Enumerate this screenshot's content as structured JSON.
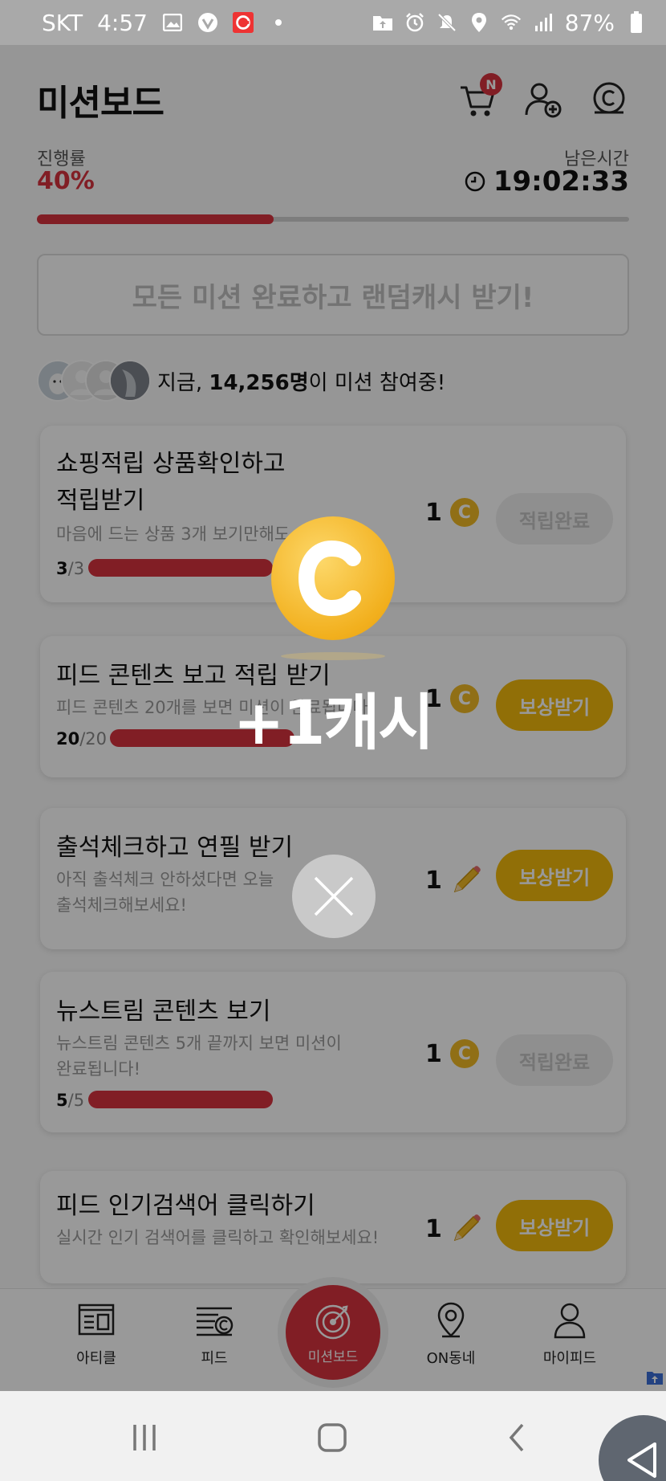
{
  "status_bar": {
    "carrier": "SKT",
    "time": "4:57",
    "battery": "87%",
    "icons": [
      "image-icon",
      "vivaldi-icon",
      "app-c-icon",
      "dot-icon",
      "upload-folder-icon",
      "alarm-icon",
      "mute-icon",
      "location-icon",
      "wifi-icon",
      "signal-icon",
      "battery-icon"
    ]
  },
  "header": {
    "title": "미션보드",
    "cart_badge": "N",
    "icons": [
      "cart-icon",
      "add-friend-icon",
      "cash-icon"
    ]
  },
  "progress": {
    "label": "진행률",
    "value": "40%",
    "fraction": 0.4,
    "time_label": "남은시간",
    "time_value": "19:02:33"
  },
  "all_missions_banner": "모든 미션 완료하고 랜덤캐시 받기!",
  "participants": {
    "prefix": "지금, ",
    "count": "14,256명",
    "suffix": "이 미션 참여중!"
  },
  "missions": [
    {
      "title1": "쇼핑적립 상품확인하고",
      "title2": "적립받기",
      "desc1": "마음에 드는 상품 3개 보기만해도",
      "done": "3",
      "total": "/3",
      "fraction": 1.0,
      "reward": "1",
      "reward_icon": "coin-icon",
      "button": "적립완료",
      "state": "done"
    },
    {
      "title1": "피드 콘텐츠 보고 적립 받기",
      "desc1": "피드 콘텐츠 20개를 보면 미션이 완료됩니다!",
      "done": "20",
      "total": "/20",
      "fraction": 1.0,
      "reward": "1",
      "reward_icon": "coin-icon",
      "button": "보상받기",
      "state": "claim"
    },
    {
      "title1": "출석체크하고 연필 받기",
      "desc1": "아직 출석체크 안하셨다면 오늘",
      "desc2": "출석체크해보세요!",
      "reward": "1",
      "reward_icon": "pencil-icon",
      "button": "보상받기",
      "state": "claim"
    },
    {
      "title1": "뉴스트림 콘텐츠 보기",
      "desc1": "뉴스트림 콘텐츠 5개 끝까지 보면 미션이",
      "desc2": "완료됩니다!",
      "done": "5",
      "total": "/5",
      "fraction": 1.0,
      "reward": "1",
      "reward_icon": "coin-icon",
      "button": "적립완료",
      "state": "done"
    },
    {
      "title1": "피드 인기검색어 클릭하기",
      "desc1": "실시간 인기 검색어를 클릭하고 확인해보세요!",
      "reward": "1",
      "reward_icon": "pencil-icon",
      "button": "보상받기",
      "state": "claim"
    }
  ],
  "tabs": [
    {
      "label": "아티클",
      "icon": "article-icon"
    },
    {
      "label": "피드",
      "icon": "feed-icon"
    },
    {
      "label": "미션보드",
      "icon": "target-icon"
    },
    {
      "label": "ON동네",
      "icon": "location-pin-icon"
    },
    {
      "label": "마이피드",
      "icon": "person-icon"
    }
  ],
  "popup": {
    "reward_text": "+1캐시",
    "coin_letter": "C"
  },
  "colors": {
    "accent_red": "#d7323e",
    "accent_yellow": "#f2b90c",
    "coin_gold": "#f0b925"
  }
}
